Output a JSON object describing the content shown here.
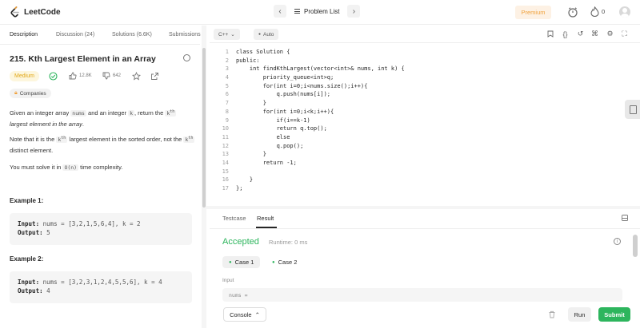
{
  "app": {
    "name": "LeetCode"
  },
  "nav": {
    "problem_list": "Problem List",
    "premium": "Premium",
    "streak": "0"
  },
  "left_tabs": [
    "Description",
    "Discussion (24)",
    "Solutions (6.6K)",
    "Submissions"
  ],
  "problem": {
    "title": "215. Kth Largest Element in an Array",
    "difficulty": "Medium",
    "likes": "12.8K",
    "dislikes": "642",
    "companies": "Companies",
    "desc1_a": "Given an integer array ",
    "desc1_code1": "nums",
    "desc1_b": " and an integer ",
    "desc1_code2": "k",
    "desc1_c": ", return the ",
    "desc1_code3": "k",
    "desc1_sup": "th",
    "desc1_d": "largest element in the array",
    "desc1_e": ".",
    "desc2_a": "Note that it is the ",
    "desc2_code1": "k",
    "desc2_sup1": "th",
    "desc2_b": " largest element in the sorted order, not the ",
    "desc2_code2": "k",
    "desc2_sup2": "th",
    "desc2_c": " distinct element.",
    "desc3_a": "You must solve it in ",
    "desc3_code": "O(n)",
    "desc3_b": " time complexity.",
    "examples": [
      {
        "title": "Example 1:",
        "input_label": "Input:",
        "input": " nums = [3,2,1,5,6,4], k = 2",
        "output_label": "Output:",
        "output": " 5"
      },
      {
        "title": "Example 2:",
        "input_label": "Input:",
        "input": " nums = [3,2,3,1,2,4,5,5,6], k = 4",
        "output_label": "Output:",
        "output": " 4"
      }
    ]
  },
  "editor": {
    "language": "C++",
    "mode": "Auto",
    "lines": [
      "class Solution {",
      "public:",
      "    int findKthLargest(vector<int>& nums, int k) {",
      "        priority_queue<int>q;",
      "        for(int i=0;i<nums.size();i++){",
      "            q.push(nums[i]);",
      "        }",
      "        for(int i=0;i<k;i++){",
      "            if(i==k-1)",
      "            return q.top();",
      "            else",
      "            q.pop();",
      "        }",
      "        return -1;",
      "",
      "    }",
      "};"
    ]
  },
  "result": {
    "tabs": [
      "Testcase",
      "Result"
    ],
    "status": "Accepted",
    "runtime": "Runtime: 0 ms",
    "cases": [
      "Case 1",
      "Case 2"
    ],
    "input_label": "Input",
    "input_value": "nums ="
  },
  "actions": {
    "console": "Console",
    "run": "Run",
    "submit": "Submit"
  },
  "colors": {
    "accent_green": "#2db55d",
    "medium_yellow": "#e0a615",
    "premium_orange": "#f0a13b"
  }
}
